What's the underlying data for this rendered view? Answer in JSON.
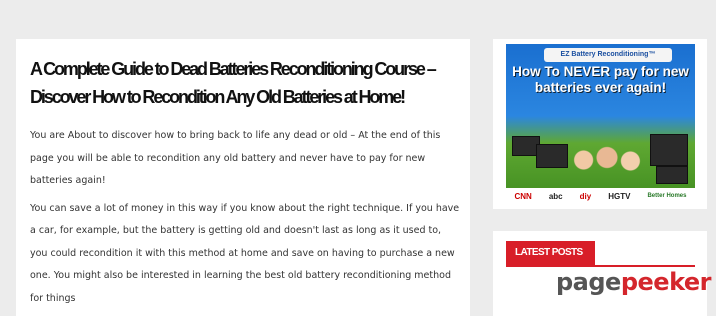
{
  "article": {
    "title": "A Complete Guide to Dead Batteries Reconditioning Course – Discover How to Recondition Any Old Batteries at Home!",
    "paragraphs": [
      "You are About to discover how to bring back to life any dead or old – At the end of this page you will be able to recondition any old battery and never have to pay for new batteries again!",
      "You can save a lot of money in this way if you know about the right technique. If you have a car, for example, but the battery is getting old and doesn't last as long as it used to, you could recondition it with this method at home and save on having to purchase a new one. You might also be interested in learning the best old battery reconditioning method for things"
    ]
  },
  "ad": {
    "banner": "EZ Battery Reconditioning™",
    "headline": "How To NEVER pay for new batteries ever again!",
    "logos": [
      "CNN",
      "abc",
      "diy",
      "HGTV",
      "Better Homes"
    ]
  },
  "sidebar": {
    "latest_posts_label": "LATEST POSTS"
  },
  "watermark": {
    "part1": "page",
    "part2": "peeker"
  }
}
